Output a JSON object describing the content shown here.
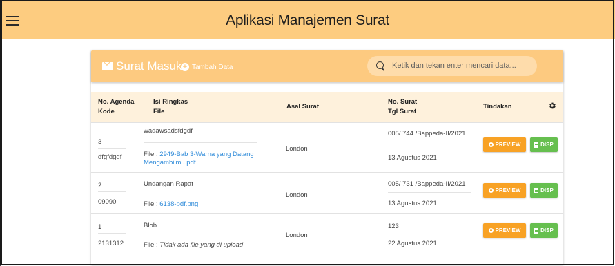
{
  "app": {
    "title": "Aplikasi Manajemen Surat"
  },
  "panel": {
    "title": "Surat Masuk",
    "add_label": "Tambah Data",
    "search_placeholder": "Ketik dan tekan enter mencari data..."
  },
  "table": {
    "headers": {
      "agenda": "No. Agenda",
      "kode": "Kode",
      "isi": "Isi Ringkas",
      "file": "File",
      "asal": "Asal Surat",
      "no_surat": "No. Surat",
      "tgl": "Tgl Surat",
      "tindakan": "Tindakan"
    },
    "file_prefix": "File : ",
    "rows": [
      {
        "agenda": "3",
        "kode": "dfgfdgdf",
        "isi": "wadawsadsfdgdf",
        "file_line1": "2949-Bab 3-Warna yang Datang",
        "file_line2": "Mengambilmu.pdf",
        "asal": "London",
        "no_surat": "005/ 744 /Bappeda-II/2021",
        "tgl": "13 Agustus 2021"
      },
      {
        "agenda": "2",
        "kode": "09090",
        "isi": "Undangan Rapat",
        "file_line1": "6138-pdf.png",
        "asal": "London",
        "no_surat": "005/ 731 /Bappeda-II/2021",
        "tgl": "13 Agustus 2021"
      },
      {
        "agenda": "1",
        "kode": "2131312",
        "isi": "Blob",
        "file_line1": "Tidak ada file yang di upload",
        "asal": "London",
        "no_surat": "123",
        "tgl": "22 Agustus 2021"
      }
    ]
  },
  "actions": {
    "preview": "PREVIEW",
    "disp": "DISP"
  },
  "colors": {
    "topbar": "#fdcc80",
    "preview": "#f8a225",
    "disp": "#66bf4f",
    "link": "#2d8ad9"
  }
}
